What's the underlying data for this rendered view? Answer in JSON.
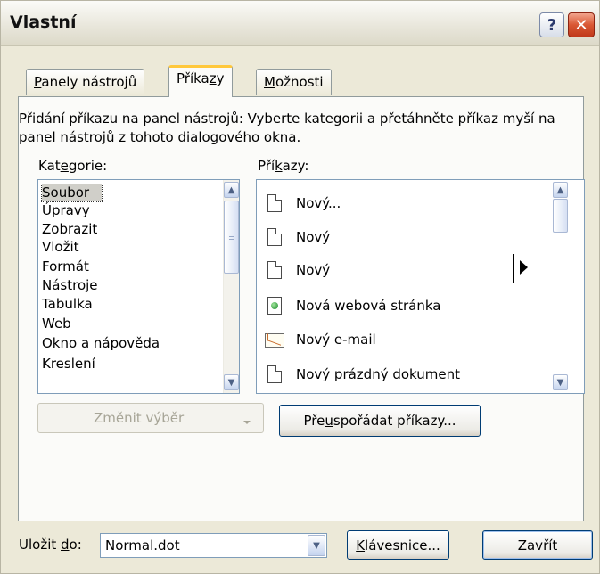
{
  "window": {
    "title": "Vlastní",
    "help_label": "?",
    "close_label": "✕"
  },
  "tabs": [
    {
      "label_pre": "",
      "label_key": "P",
      "label_post": "anely nástrojů"
    },
    {
      "label_pre": "Příka",
      "label_key": "z",
      "label_post": "y"
    },
    {
      "label_pre": "",
      "label_key": "M",
      "label_post": "ožnosti"
    }
  ],
  "description": "Přidání příkazu na panel nástrojů: Vyberte kategorii a přetáhněte příkaz myší na panel nástrojů z tohoto dialogového okna.",
  "categories_label": {
    "pre": "Kat",
    "key": "e",
    "post": "gorie:"
  },
  "commands_label": {
    "pre": "Pří",
    "key": "k",
    "post": "azy:"
  },
  "categories": [
    "Soubor",
    "Úpravy",
    "Zobrazit",
    "Vložit",
    "Formát",
    "Nástroje",
    "Tabulka",
    "Web",
    "Okno a nápověda",
    "Kreslení"
  ],
  "selected_category": "Soubor",
  "commands": [
    {
      "label": "Nový...",
      "icon": "blank-document-icon"
    },
    {
      "label": "Nový",
      "icon": "blank-document-icon"
    },
    {
      "label": "Nový",
      "icon": "blank-document-icon"
    },
    {
      "label": "Nová webová stránka",
      "icon": "web-page-icon"
    },
    {
      "label": "Nový e-mail",
      "icon": "email-icon"
    },
    {
      "label": "Nový prázdný dokument",
      "icon": "blank-document-icon"
    }
  ],
  "buttons": {
    "modify_selection": "Změnit výběr",
    "rearrange": {
      "pre": "Pře",
      "key": "u",
      "post": "spořádat příkazy..."
    },
    "keyboard": {
      "pre": "",
      "key": "K",
      "post": "lávesnice..."
    },
    "close": "Zavřít"
  },
  "save_in": {
    "pre": "Uložit ",
    "key": "d",
    "post": "o:",
    "value": "Normal.dot"
  }
}
